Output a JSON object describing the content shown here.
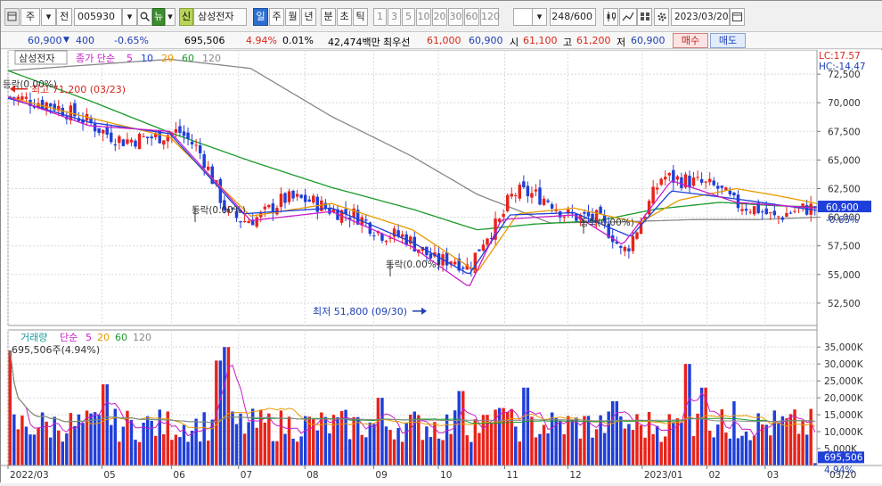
{
  "toolbar": {
    "type_label": "주",
    "period_label": "전",
    "code": "005930",
    "news_label": "뉴",
    "credit_label": "신",
    "stock_name": "삼성전자",
    "periods": [
      "일",
      "주",
      "월",
      "년",
      "분",
      "초",
      "틱"
    ],
    "active_period": "일",
    "intervals": [
      "1",
      "3",
      "5",
      "10",
      "20",
      "30",
      "60",
      "120"
    ],
    "count": "248",
    "count_max": "/600",
    "date": "2023/03/20"
  },
  "quote": {
    "price": "60,900",
    "change": "400",
    "change_pct": "-0.65%",
    "volume": "695,506",
    "volume_pct": "4.94%",
    "turnover": "0.01%",
    "amount": "42,474백만",
    "best_label": "최우선",
    "best_ask": "61,000",
    "best_bid": "60,900",
    "open_label": "시",
    "open": "61,100",
    "high_label": "고",
    "high": "61,200",
    "low_label": "저",
    "low": "60,900",
    "buy_label": "매수",
    "sell_label": "매도"
  },
  "price_panel": {
    "name": "삼성전자",
    "legend_prefix": "종가 단순",
    "ma": [
      {
        "label": "5",
        "color": "#c81ec8"
      },
      {
        "label": "10",
        "color": "#1f3fd9"
      },
      {
        "label": "20",
        "color": "#e89a00"
      },
      {
        "label": "60",
        "color": "#1a9a2a"
      },
      {
        "label": "120",
        "color": "#888888"
      }
    ],
    "lc": "LC:17.57",
    "hc": "HC:-14.47",
    "current_price": "60,900",
    "current_pct": "-0.65%",
    "high_annot": "최고 71,200 (03/23)",
    "low_annot": "최저 51,800 (09/30)",
    "drop_labels": [
      "등락(0.00%)",
      "등락(0.00%)",
      "등락(0.00%)",
      "등락(0.00%)"
    ]
  },
  "volume_panel": {
    "title": "거래량",
    "legend_prefix": "단순",
    "ma": [
      {
        "label": "5",
        "color": "#c81ec8"
      },
      {
        "label": "20",
        "color": "#e89a00"
      },
      {
        "label": "60",
        "color": "#1a9a2a"
      },
      {
        "label": "120",
        "color": "#888888"
      }
    ],
    "current_text": "695,506주(4.94%)",
    "current_value": "695,506",
    "current_pct": "4.94%"
  },
  "x_axis": {
    "labels": [
      "2022/03",
      "05",
      "06",
      "07",
      "08",
      "09",
      "10",
      "11",
      "12",
      "2023/01",
      "02",
      "03"
    ],
    "right_label": "03/20"
  },
  "chart_data": [
    {
      "type": "candlestick",
      "title": "삼성전자",
      "y_ticks": [
        52500,
        55000,
        57500,
        60000,
        62500,
        65000,
        67500,
        70000,
        72500
      ],
      "y_tick_labels": [
        "52,500",
        "55,000",
        "57,500",
        "60,000",
        "62,500",
        "65,000",
        "67,500",
        "70,000",
        "72,500"
      ],
      "ylim": [
        50700,
        74300
      ],
      "x_labels": [
        "2022/03",
        "05",
        "06",
        "07",
        "08",
        "09",
        "10",
        "11",
        "12",
        "2023/01",
        "02",
        "03"
      ],
      "close_path": [
        [
          0,
          70500
        ],
        [
          0.05,
          69900
        ],
        [
          0.09,
          68600
        ],
        [
          0.12,
          67300
        ],
        [
          0.14,
          66700
        ],
        [
          0.18,
          67000
        ],
        [
          0.21,
          67500
        ],
        [
          0.23,
          66200
        ],
        [
          0.24,
          65200
        ],
        [
          0.27,
          60300
        ],
        [
          0.29,
          59700
        ],
        [
          0.31,
          60000
        ],
        [
          0.34,
          61600
        ],
        [
          0.37,
          61500
        ],
        [
          0.4,
          60600
        ],
        [
          0.43,
          60200
        ],
        [
          0.46,
          58600
        ],
        [
          0.49,
          58300
        ],
        [
          0.51,
          57200
        ],
        [
          0.53,
          56100
        ],
        [
          0.55,
          56400
        ],
        [
          0.57,
          55600
        ],
        [
          0.59,
          58300
        ],
        [
          0.61,
          59700
        ],
        [
          0.62,
          61600
        ],
        [
          0.63,
          62200
        ],
        [
          0.65,
          62000
        ],
        [
          0.67,
          61500
        ],
        [
          0.69,
          60200
        ],
        [
          0.71,
          60000
        ],
        [
          0.73,
          59900
        ],
        [
          0.75,
          58300
        ],
        [
          0.76,
          56800
        ],
        [
          0.77,
          57700
        ],
        [
          0.79,
          60600
        ],
        [
          0.81,
          63600
        ],
        [
          0.82,
          63400
        ],
        [
          0.84,
          63200
        ],
        [
          0.86,
          62900
        ],
        [
          0.88,
          62500
        ],
        [
          0.9,
          61200
        ],
        [
          0.93,
          60700
        ],
        [
          0.95,
          59900
        ],
        [
          0.97,
          60500
        ],
        [
          1,
          60900
        ]
      ],
      "ma5": [
        [
          0,
          70500
        ],
        [
          0.1,
          68000
        ],
        [
          0.2,
          67500
        ],
        [
          0.3,
          59700
        ],
        [
          0.4,
          60500
        ],
        [
          0.5,
          57400
        ],
        [
          0.57,
          53900
        ],
        [
          0.61,
          59800
        ],
        [
          0.7,
          60200
        ],
        [
          0.76,
          57600
        ],
        [
          0.82,
          63200
        ],
        [
          0.9,
          61300
        ],
        [
          1,
          60800
        ]
      ],
      "ma10": [
        [
          0,
          70400
        ],
        [
          0.1,
          68300
        ],
        [
          0.2,
          67300
        ],
        [
          0.29,
          60300
        ],
        [
          0.4,
          60800
        ],
        [
          0.5,
          57800
        ],
        [
          0.57,
          55000
        ],
        [
          0.62,
          60200
        ],
        [
          0.7,
          60400
        ],
        [
          0.77,
          58300
        ],
        [
          0.82,
          62300
        ],
        [
          0.9,
          61600
        ],
        [
          1,
          60600
        ]
      ],
      "ma20": [
        [
          0,
          70500
        ],
        [
          0.1,
          68700
        ],
        [
          0.2,
          67000
        ],
        [
          0.3,
          60100
        ],
        [
          0.4,
          61200
        ],
        [
          0.5,
          58900
        ],
        [
          0.58,
          55200
        ],
        [
          0.63,
          60300
        ],
        [
          0.7,
          60800
        ],
        [
          0.78,
          59500
        ],
        [
          0.83,
          61500
        ],
        [
          0.9,
          62500
        ],
        [
          0.95,
          61900
        ],
        [
          1,
          61200
        ]
      ],
      "ma60": [
        [
          0,
          72800
        ],
        [
          0.1,
          70200
        ],
        [
          0.2,
          67400
        ],
        [
          0.3,
          64900
        ],
        [
          0.4,
          62600
        ],
        [
          0.5,
          60700
        ],
        [
          0.58,
          58900
        ],
        [
          0.65,
          59400
        ],
        [
          0.73,
          59700
        ],
        [
          0.8,
          60700
        ],
        [
          0.88,
          61300
        ],
        [
          0.95,
          61000
        ],
        [
          1,
          60900
        ]
      ],
      "ma120": [
        [
          0,
          72800
        ],
        [
          0.2,
          73800
        ],
        [
          0.3,
          73000
        ],
        [
          0.4,
          68800
        ],
        [
          0.5,
          65300
        ],
        [
          0.58,
          62000
        ],
        [
          0.67,
          59500
        ],
        [
          0.76,
          59600
        ],
        [
          0.85,
          59800
        ],
        [
          0.93,
          59800
        ],
        [
          1,
          60000
        ]
      ]
    },
    {
      "type": "bar",
      "title": "거래량",
      "y_ticks": [
        5000,
        10000,
        15000,
        20000,
        25000,
        30000,
        35000
      ],
      "y_tick_labels": [
        "5,000K",
        "10,000K",
        "15,000K",
        "20,000K",
        "25,000K",
        "30,000K",
        "35,000K"
      ],
      "ylim": [
        0,
        39000
      ],
      "bar_count": 200,
      "spikes": [
        [
          0,
          34000
        ],
        [
          0.12,
          24000
        ],
        [
          0.26,
          31000
        ],
        [
          0.27,
          35000
        ],
        [
          0.46,
          20000
        ],
        [
          0.56,
          22000
        ],
        [
          0.61,
          17000
        ],
        [
          0.64,
          23000
        ],
        [
          0.75,
          19000
        ],
        [
          0.84,
          30000
        ],
        [
          0.86,
          23000
        ],
        [
          0.9,
          19000
        ]
      ],
      "base_volume": 12500
    }
  ]
}
